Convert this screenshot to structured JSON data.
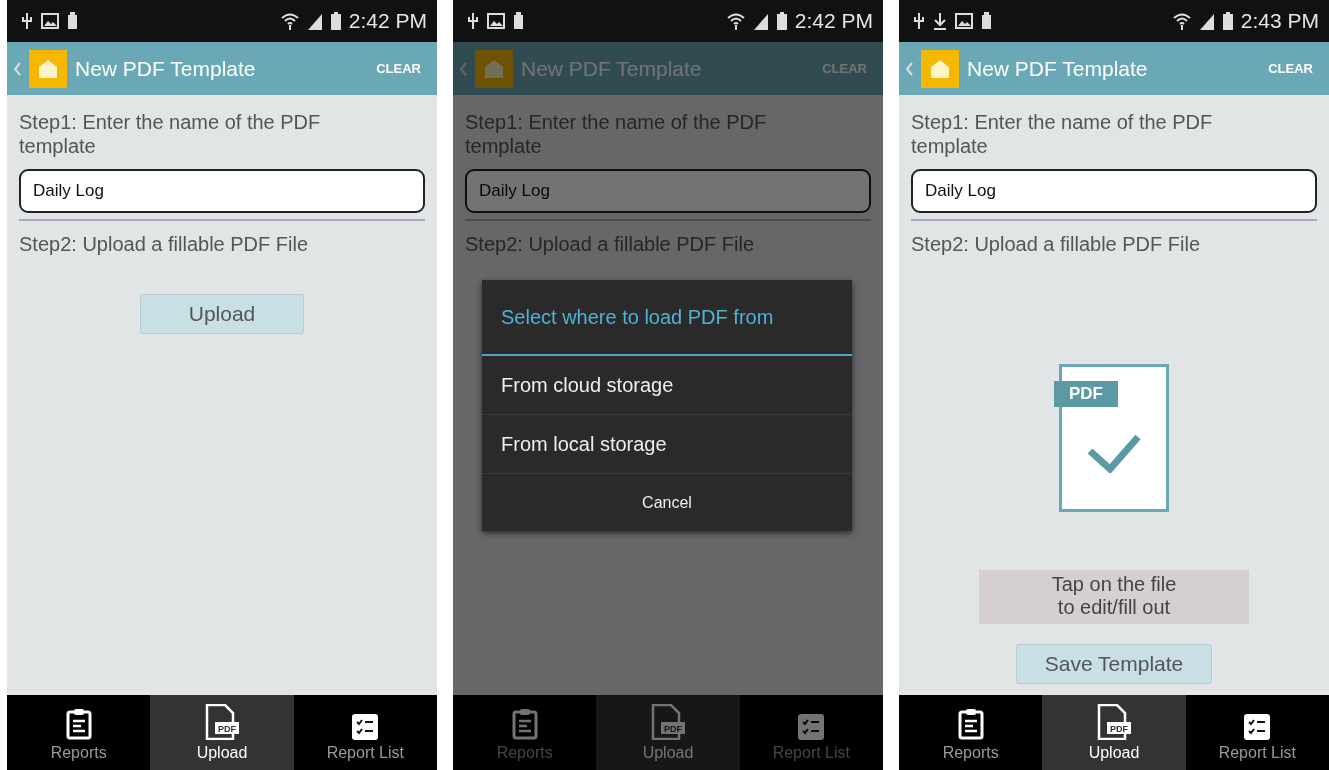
{
  "screens": [
    {
      "kind": "upload",
      "dimmed": false,
      "status_bar": {
        "time": "2:42 PM",
        "download_notification": false
      },
      "app_bar": {
        "title": "New PDF Template",
        "action": "CLEAR"
      },
      "step1": "Step1: Enter the name of the PDF template",
      "name_field": {
        "value": "Daily Log"
      },
      "step2": "Step2: Upload a fillable PDF File",
      "upload_button": "Upload",
      "tabs": [
        {
          "label": "Reports",
          "kind": "clipboard",
          "selected": false
        },
        {
          "label": "Upload",
          "kind": "pdf",
          "badge": "PDF",
          "selected": true
        },
        {
          "label": "Report List",
          "kind": "checklist",
          "selected": false
        }
      ]
    },
    {
      "kind": "dialog",
      "dimmed": true,
      "status_bar": {
        "time": "2:42 PM",
        "download_notification": false
      },
      "app_bar": {
        "title": "New PDF Template",
        "action": "CLEAR"
      },
      "step1": "Step1: Enter the name of the PDF template",
      "name_field": {
        "value": "Daily Log"
      },
      "step2": "Step2: Upload a fillable PDF File",
      "dialog": {
        "title": "Select where to load PDF from",
        "options": [
          "From cloud storage",
          "From local storage"
        ],
        "cancel": "Cancel"
      },
      "tabs": [
        {
          "label": "Reports",
          "kind": "clipboard",
          "selected": false
        },
        {
          "label": "Upload",
          "kind": "pdf",
          "badge": "PDF",
          "selected": true
        },
        {
          "label": "Report List",
          "kind": "checklist",
          "selected": false
        }
      ]
    },
    {
      "kind": "uploaded",
      "dimmed": false,
      "status_bar": {
        "time": "2:43 PM",
        "download_notification": true
      },
      "app_bar": {
        "title": "New PDF Template",
        "action": "CLEAR"
      },
      "step1": "Step1: Enter the name of the PDF template",
      "name_field": {
        "value": "Daily Log"
      },
      "step2": "Step2: Upload a fillable PDF File",
      "file": {
        "badge": "PDF"
      },
      "hint": "Tap on the file to edit/fill out",
      "save_button": "Save Template",
      "tabs": [
        {
          "label": "Reports",
          "kind": "clipboard",
          "selected": false
        },
        {
          "label": "Upload",
          "kind": "pdf",
          "badge": "PDF",
          "selected": true
        },
        {
          "label": "Report List",
          "kind": "checklist",
          "selected": false
        }
      ]
    }
  ]
}
